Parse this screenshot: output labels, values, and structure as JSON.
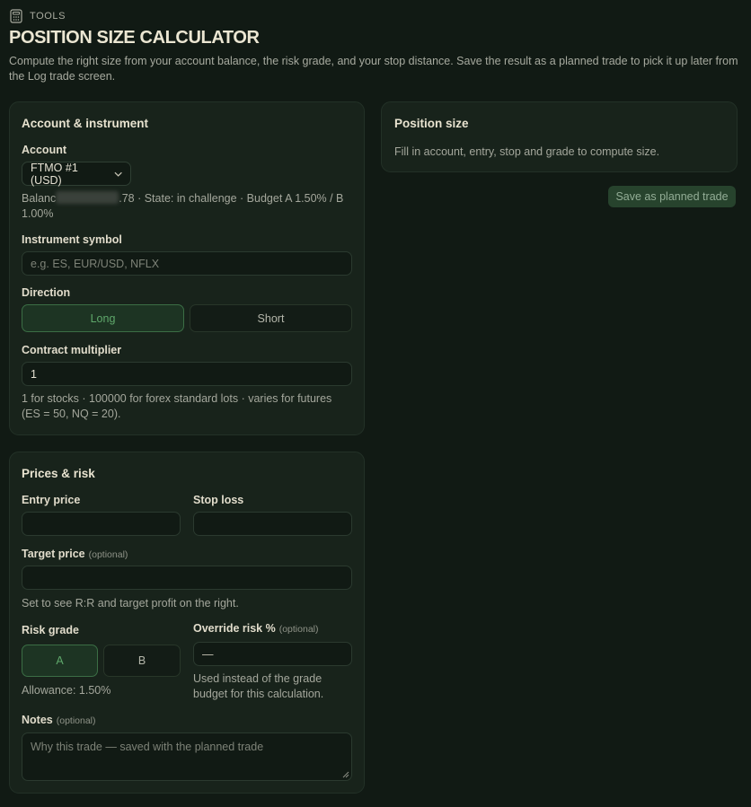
{
  "header": {
    "section_label": "TOOLS",
    "title": "POSITION SIZE CALCULATOR",
    "description": "Compute the right size from your account balance, the risk grade, and your stop distance. Save the result as a planned trade to pick it up later from the Log trade screen."
  },
  "account_card": {
    "title": "Account & instrument",
    "account_label": "Account",
    "account_value": "FTMO #1 (USD)",
    "balance_prefix": "Balanc",
    "balance_suffix": ".78 · State: in challenge · Budget A 1.50% / B 1.00%",
    "symbol_label": "Instrument symbol",
    "symbol_placeholder": "e.g. ES, EUR/USD, NFLX",
    "direction_label": "Direction",
    "direction_long": "Long",
    "direction_short": "Short",
    "multiplier_label": "Contract multiplier",
    "multiplier_value": "1",
    "multiplier_help": "1 for stocks · 100000 for forex standard lots · varies for futures (ES = 50, NQ = 20)."
  },
  "position_card": {
    "title": "Position size",
    "message": "Fill in account, entry, stop and grade to compute size."
  },
  "save_button": "Save as planned trade",
  "prices_card": {
    "title": "Prices & risk",
    "entry_label": "Entry price",
    "stop_label": "Stop loss",
    "target_label": "Target price",
    "target_optional": "(optional)",
    "target_help": "Set to see R:R and target profit on the right.",
    "grade_label": "Risk grade",
    "grade_a": "A",
    "grade_b": "B",
    "allowance": "Allowance: 1.50%",
    "override_label": "Override risk %",
    "override_optional": "(optional)",
    "override_placeholder": "—",
    "override_help": "Used instead of the grade budget for this calculation.",
    "notes_label": "Notes",
    "notes_optional": "(optional)",
    "notes_placeholder": "Why this trade — saved with the planned trade"
  },
  "colors": {
    "background": "#111a14",
    "card": "#18231b",
    "accent_green": "#5fa86b",
    "save_button": "#27432d"
  }
}
